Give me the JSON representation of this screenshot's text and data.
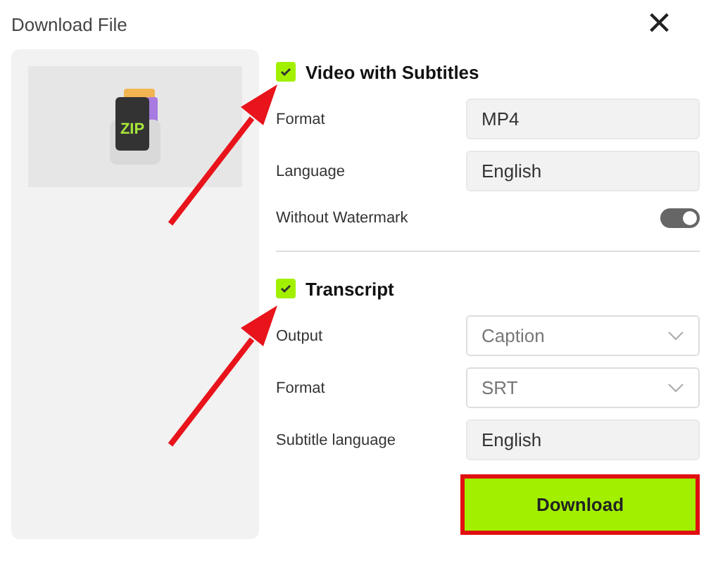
{
  "window": {
    "title": "Download File",
    "close": "×"
  },
  "preview": {
    "kind": "picture",
    "badge": "ZIP"
  },
  "sections": [
    {
      "title": "Video with Subtitles",
      "checked": true,
      "fields": [
        {
          "label": "Format",
          "kind": "input",
          "value": "MP4"
        },
        {
          "label": "Language",
          "kind": "input",
          "value": "English"
        },
        {
          "label": "Without Watermark",
          "kind": "toggle",
          "on": true
        }
      ]
    },
    {
      "title": "Transcript",
      "checked": true,
      "fields": [
        {
          "label": "Output",
          "kind": "select",
          "value": "Caption"
        },
        {
          "label": "Format",
          "kind": "select",
          "value": "SRT"
        },
        {
          "label": "Subtitle language",
          "kind": "input",
          "value": "English"
        }
      ]
    }
  ],
  "download": {
    "label": "Download",
    "highlighted": true
  },
  "annotations": [
    {
      "kind": "arrow"
    },
    {
      "kind": "arrow"
    }
  ]
}
